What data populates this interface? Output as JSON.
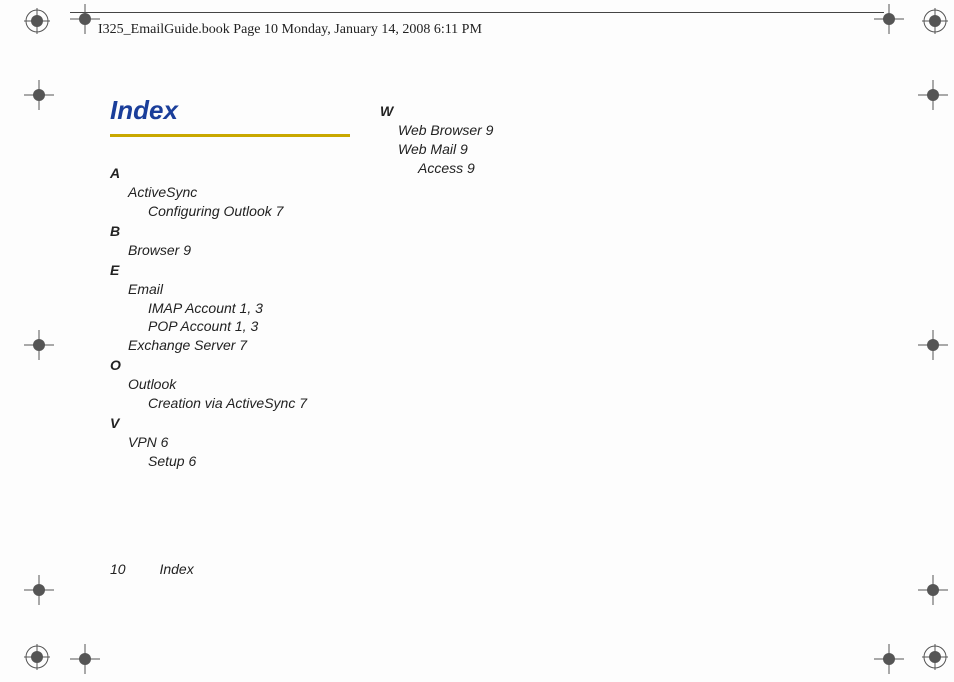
{
  "header_text": "I325_EmailGuide.book  Page 10  Monday, January 14, 2008  6:11 PM",
  "title": "Index",
  "col1": [
    {
      "type": "letter",
      "text": "A"
    },
    {
      "type": "entry",
      "text": "ActiveSync"
    },
    {
      "type": "subentry",
      "text": "Configuring Outlook 7"
    },
    {
      "type": "letter",
      "text": "B"
    },
    {
      "type": "entry",
      "text": "Browser 9"
    },
    {
      "type": "letter",
      "text": "E"
    },
    {
      "type": "entry",
      "text": "Email"
    },
    {
      "type": "subentry",
      "text": "IMAP Account 1, 3"
    },
    {
      "type": "subentry",
      "text": "POP Account 1, 3"
    },
    {
      "type": "entry",
      "text": "Exchange Server 7"
    },
    {
      "type": "letter",
      "text": "O"
    },
    {
      "type": "entry",
      "text": "Outlook"
    },
    {
      "type": "subentry",
      "text": "Creation via ActiveSync 7"
    },
    {
      "type": "letter",
      "text": "V"
    },
    {
      "type": "entry",
      "text": "VPN 6"
    },
    {
      "type": "subentry",
      "text": "Setup 6"
    }
  ],
  "col2": [
    {
      "type": "letter",
      "text": "W"
    },
    {
      "type": "entry",
      "text": "Web Browser 9"
    },
    {
      "type": "entry",
      "text": "Web Mail 9"
    },
    {
      "type": "subentry",
      "text": "Access 9"
    }
  ],
  "footer_page": "10",
  "footer_label": "Index"
}
